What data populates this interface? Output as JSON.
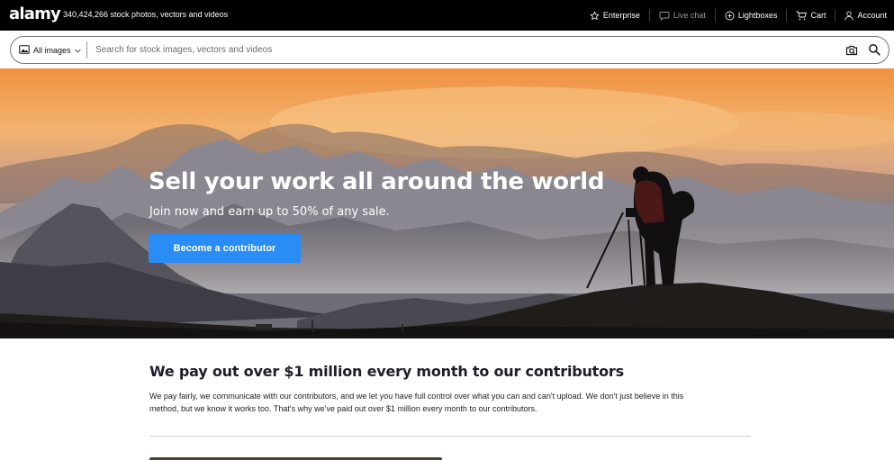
{
  "brand": {
    "logo": "alamy",
    "tagline": "340,424,266 stock photos, vectors and videos"
  },
  "nav": {
    "enterprise": "Enterprise",
    "live_chat": "Live chat",
    "lightboxes": "Lightboxes",
    "cart": "Cart",
    "account": "Account"
  },
  "search": {
    "scope_label": "All images",
    "placeholder": "Search for stock images, vectors and videos",
    "value": ""
  },
  "hero": {
    "title": "Sell your work all around the world",
    "subtitle": "Join now and earn up to 50% of any sale.",
    "cta_label": "Become a contributor"
  },
  "payout": {
    "title": "We pay out over $1 million every month to our contributors",
    "body_line1": "We pay fairly, we communicate with our contributors, and we let you have full control over what you can and can't upload. We don't just believe in this",
    "body_line2": "method, but we know it works too. That's why we've paid out over $1 million every month to our contributors."
  },
  "colors": {
    "topbar": "#000000",
    "accent_button": "#2a8cf5",
    "muted_nav": "#9a9a9a"
  },
  "icons": [
    "star-icon",
    "chat-bubble-icon",
    "plus-circle-icon",
    "cart-icon",
    "user-icon",
    "image-icon",
    "chevron-down-icon",
    "camera-search-icon",
    "search-icon"
  ]
}
